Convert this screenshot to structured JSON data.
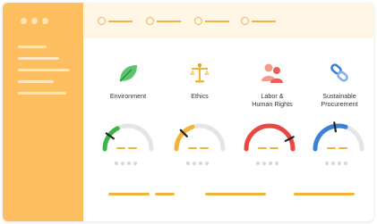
{
  "colors": {
    "sidebar": "#fdbe5f",
    "accent": "#f2b33d",
    "topbar": "#fff6e6",
    "gauge_track": "#e5e5e5",
    "green": "#39b54a",
    "yellow": "#f2b33d",
    "red": "#e8483f",
    "blue": "#3b82d6"
  },
  "categories": [
    {
      "label": "Environment",
      "icon": "leaf-icon",
      "gauge_color": "green",
      "gauge_value_percent": 20
    },
    {
      "label": "Ethics",
      "icon": "scales-icon",
      "gauge_color": "yellow",
      "gauge_value_percent": 25
    },
    {
      "label": "Labor &\nHuman Rights",
      "icon": "people-icon",
      "gauge_color": "red",
      "gauge_value_percent": 85
    },
    {
      "label": "Sustainable\nProcurement",
      "icon": "recycle-link-icon",
      "gauge_color": "blue",
      "gauge_value_percent": 45
    }
  ]
}
